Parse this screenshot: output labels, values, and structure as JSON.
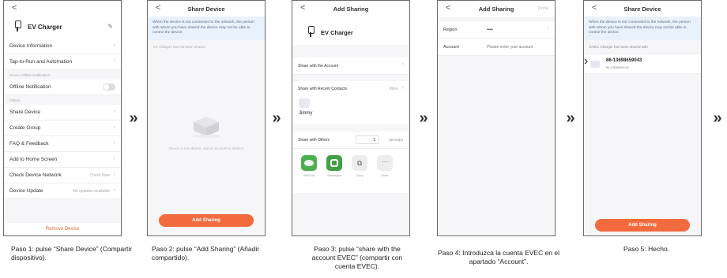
{
  "arrow_glyph": "»",
  "screen1": {
    "back": "<",
    "device_name": "EV Charger",
    "edit_icon": "pencil-icon",
    "menu": [
      {
        "label": "Device Information"
      },
      {
        "label": "Tap-to-Run and Automation"
      }
    ],
    "offline_section": "Device Offline Notification",
    "offline_label": "Offline Notification",
    "others_section": "Others",
    "others": [
      {
        "label": "Share Device",
        "right": ""
      },
      {
        "label": "Create Group",
        "right": ""
      },
      {
        "label": "FAQ & Feedback",
        "right": ""
      },
      {
        "label": "Add to Home Screen",
        "right": ""
      },
      {
        "label": "Check Device Network",
        "right": "Check Now"
      },
      {
        "label": "Device Update",
        "right": "No updates available"
      }
    ],
    "remove": "Remove Device"
  },
  "screen2": {
    "back": "<",
    "title": "Share Device",
    "notice": "When the device is not connected to the network, the person with whom you have shared the device may not be able to control the device.",
    "shared_line": "EV Charger has not been shared.",
    "empty_text": "Device is not shared, add an account to share it",
    "button": "Add Sharing"
  },
  "screen3": {
    "back": "<",
    "title": "Add Sharing",
    "device_name": "EV Charger",
    "share_account": "Share with the Account",
    "recent_label": "Share with Recent Contacts",
    "recent_right": "More",
    "contact_name": "Jimmy",
    "others_label": "Share with Others",
    "period_value": "1",
    "period_unit": "period(s)",
    "apps": [
      {
        "label": "WeChat",
        "icon": "wechat-icon",
        "color": "#4caf50"
      },
      {
        "label": "Messages",
        "icon": "messages-icon",
        "color": "#43a047"
      },
      {
        "label": "Copy",
        "icon": "copy-icon",
        "color": "#ededed"
      },
      {
        "label": "More",
        "icon": "more-icon",
        "color": "#ededed"
      }
    ]
  },
  "screen4": {
    "back": "<",
    "title": "Add Sharing",
    "done": "Done",
    "region_label": "Region",
    "region_value": "••••",
    "account_label": "Account",
    "account_placeholder": "Please enter your account"
  },
  "screen5": {
    "back": "<",
    "title": "Share Device",
    "notice": "When the device is not connected to the network, the person with whom you have shared the device may not be able to control the device.",
    "shared_line": "EVEC Charger has been shared with",
    "account": "86-13698659043",
    "account_sub": "86-13698659043",
    "button": "Add Sharing"
  },
  "captions": [
    "Paso 1: pulse “Share Device” (Compartir dispositivo).",
    "Paso 2: pulse “Add Sharing” (Añadir compartido).",
    "Paso 3: pulse “share with the account EVEC” (compartir con cuenta EVEC).",
    "Paso 4: Introduzca la cuenta EVEC en el apartado “Account”.",
    "Paso 5: Hecho."
  ]
}
